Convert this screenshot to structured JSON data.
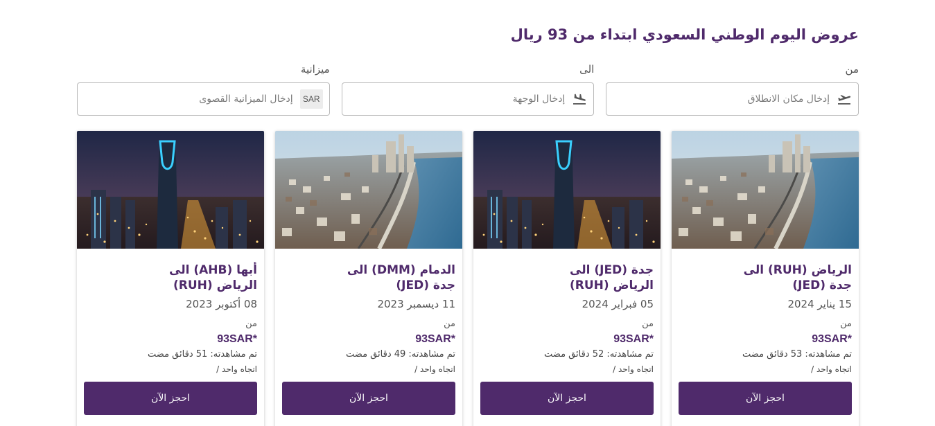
{
  "page": {
    "title": "عروض اليوم الوطني السعودي ابتداء من 93 ريال"
  },
  "filters": {
    "from": {
      "label": "من",
      "placeholder": "إدخال مكان الانطلاق",
      "icon": "plane-takeoff-icon"
    },
    "to": {
      "label": "الى",
      "placeholder": "إدخال الوجهة",
      "icon": "plane-landing-icon"
    },
    "budget": {
      "label": "ميزانية",
      "placeholder": "إدخال الميزانية القصوى",
      "currency": "SAR"
    }
  },
  "cards": [
    {
      "image": "riyadh-jeddah-corniche-photo",
      "route_line1": "الرياض (RUH) الى",
      "route_line2": "جدة (JED)",
      "date": "15 يناير 2024",
      "from_label": "من",
      "price": "93SAR*",
      "viewed": "تم مشاهدته: 53 دقائق مضت",
      "trip": "اتجاه واحد  /",
      "button": "احجز الآن"
    },
    {
      "image": "riyadh-kingdom-tower-night-photo",
      "route_line1": "جدة (JED) الى",
      "route_line2": "الرياض (RUH)",
      "date": "05 فبراير 2024",
      "from_label": "من",
      "price": "93SAR*",
      "viewed": "تم مشاهدته: 52 دقائق مضت",
      "trip": "اتجاه واحد  /",
      "button": "احجز الآن"
    },
    {
      "image": "jeddah-corniche-photo",
      "route_line1": "الدمام (DMM) الى",
      "route_line2": "جدة (JED)",
      "date": "11 ديسمبر 2023",
      "from_label": "من",
      "price": "93SAR*",
      "viewed": "تم مشاهدته: 49 دقائق مضت",
      "trip": "اتجاه واحد  /",
      "button": "احجز الآن"
    },
    {
      "image": "riyadh-kingdom-tower-night-photo",
      "route_line1": "أبها (AHB) الى",
      "route_line2": "الرياض (RUH)",
      "date": "08 أكتوبر 2023",
      "from_label": "من",
      "price": "93SAR*",
      "viewed": "تم مشاهدته: 51 دقائق مضت",
      "trip": "اتجاه واحد  /",
      "button": "احجز الآن"
    }
  ],
  "colors": {
    "brand_purple": "#4f2a6b",
    "border": "#b9b9b9"
  }
}
